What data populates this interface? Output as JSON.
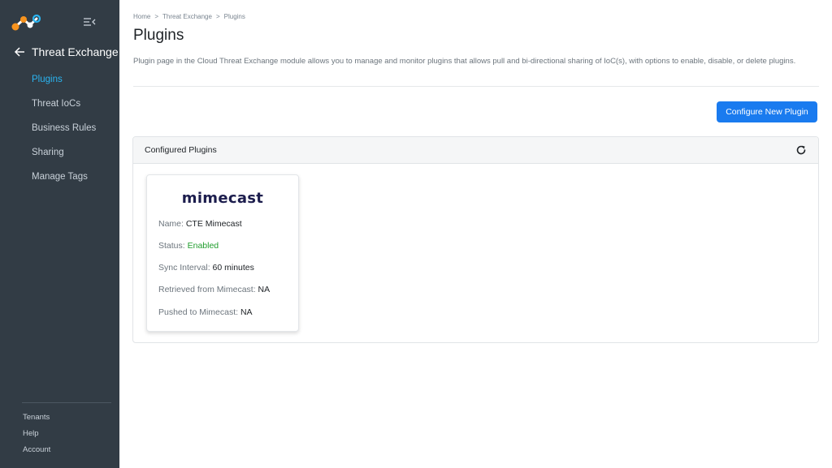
{
  "sidebar": {
    "back_label": "Threat Exchange",
    "nav_items": [
      {
        "label": "Plugins",
        "active": true
      },
      {
        "label": "Threat IoCs",
        "active": false
      },
      {
        "label": "Business Rules",
        "active": false
      },
      {
        "label": "Sharing",
        "active": false
      },
      {
        "label": "Manage Tags",
        "active": false
      }
    ],
    "footer_links": [
      "Tenants",
      "Help",
      "Account"
    ]
  },
  "breadcrumb": [
    "Home",
    "Threat Exchange",
    "Plugins"
  ],
  "breadcrumb_separator": ">",
  "page": {
    "title": "Plugins",
    "description": "Plugin page in the Cloud Threat Exchange module allows you to manage and monitor plugins that allows pull and bi-directional sharing of IoC(s), with options to enable, disable, or delete plugins."
  },
  "actions": {
    "configure_label": "Configure New Plugin"
  },
  "panel": {
    "title": "Configured Plugins"
  },
  "plugin_card": {
    "logo_text": "mimecast",
    "rows": [
      {
        "label": "Name: ",
        "value": "CTE Mimecast"
      },
      {
        "label": "Status: ",
        "value": "Enabled"
      },
      {
        "label": "Sync Interval: ",
        "value": "60 minutes"
      },
      {
        "label": "Retrieved from Mimecast: ",
        "value": "NA"
      },
      {
        "label": "Pushed to Mimecast: ",
        "value": "NA"
      }
    ]
  },
  "colors": {
    "sidebar_bg": "#323c45",
    "accent": "#1a7bef",
    "active_nav": "#2ab4f0",
    "status_enabled": "#1f9d2c",
    "logo_orange": "#f7931e",
    "logo_blue": "#2ab4f0"
  },
  "icons": [
    "netskope-logo",
    "collapse-menu-icon",
    "back-arrow-icon",
    "refresh-icon"
  ]
}
